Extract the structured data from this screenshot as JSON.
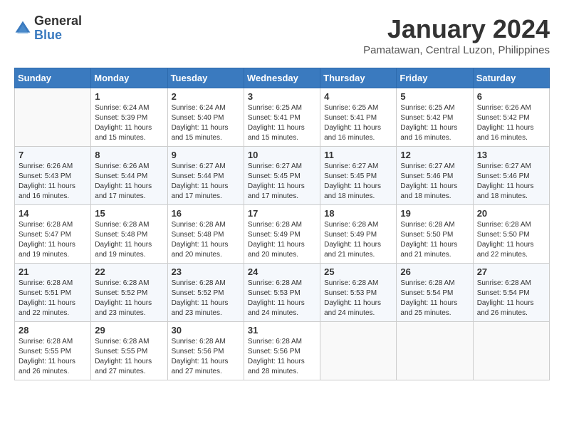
{
  "logo": {
    "general": "General",
    "blue": "Blue"
  },
  "header": {
    "month": "January 2024",
    "location": "Pamatawan, Central Luzon, Philippines"
  },
  "weekdays": [
    "Sunday",
    "Monday",
    "Tuesday",
    "Wednesday",
    "Thursday",
    "Friday",
    "Saturday"
  ],
  "weeks": [
    [
      {
        "day": "",
        "info": ""
      },
      {
        "day": "1",
        "info": "Sunrise: 6:24 AM\nSunset: 5:39 PM\nDaylight: 11 hours\nand 15 minutes."
      },
      {
        "day": "2",
        "info": "Sunrise: 6:24 AM\nSunset: 5:40 PM\nDaylight: 11 hours\nand 15 minutes."
      },
      {
        "day": "3",
        "info": "Sunrise: 6:25 AM\nSunset: 5:41 PM\nDaylight: 11 hours\nand 15 minutes."
      },
      {
        "day": "4",
        "info": "Sunrise: 6:25 AM\nSunset: 5:41 PM\nDaylight: 11 hours\nand 16 minutes."
      },
      {
        "day": "5",
        "info": "Sunrise: 6:25 AM\nSunset: 5:42 PM\nDaylight: 11 hours\nand 16 minutes."
      },
      {
        "day": "6",
        "info": "Sunrise: 6:26 AM\nSunset: 5:42 PM\nDaylight: 11 hours\nand 16 minutes."
      }
    ],
    [
      {
        "day": "7",
        "info": "Sunrise: 6:26 AM\nSunset: 5:43 PM\nDaylight: 11 hours\nand 16 minutes."
      },
      {
        "day": "8",
        "info": "Sunrise: 6:26 AM\nSunset: 5:44 PM\nDaylight: 11 hours\nand 17 minutes."
      },
      {
        "day": "9",
        "info": "Sunrise: 6:27 AM\nSunset: 5:44 PM\nDaylight: 11 hours\nand 17 minutes."
      },
      {
        "day": "10",
        "info": "Sunrise: 6:27 AM\nSunset: 5:45 PM\nDaylight: 11 hours\nand 17 minutes."
      },
      {
        "day": "11",
        "info": "Sunrise: 6:27 AM\nSunset: 5:45 PM\nDaylight: 11 hours\nand 18 minutes."
      },
      {
        "day": "12",
        "info": "Sunrise: 6:27 AM\nSunset: 5:46 PM\nDaylight: 11 hours\nand 18 minutes."
      },
      {
        "day": "13",
        "info": "Sunrise: 6:27 AM\nSunset: 5:46 PM\nDaylight: 11 hours\nand 18 minutes."
      }
    ],
    [
      {
        "day": "14",
        "info": "Sunrise: 6:28 AM\nSunset: 5:47 PM\nDaylight: 11 hours\nand 19 minutes."
      },
      {
        "day": "15",
        "info": "Sunrise: 6:28 AM\nSunset: 5:48 PM\nDaylight: 11 hours\nand 19 minutes."
      },
      {
        "day": "16",
        "info": "Sunrise: 6:28 AM\nSunset: 5:48 PM\nDaylight: 11 hours\nand 20 minutes."
      },
      {
        "day": "17",
        "info": "Sunrise: 6:28 AM\nSunset: 5:49 PM\nDaylight: 11 hours\nand 20 minutes."
      },
      {
        "day": "18",
        "info": "Sunrise: 6:28 AM\nSunset: 5:49 PM\nDaylight: 11 hours\nand 21 minutes."
      },
      {
        "day": "19",
        "info": "Sunrise: 6:28 AM\nSunset: 5:50 PM\nDaylight: 11 hours\nand 21 minutes."
      },
      {
        "day": "20",
        "info": "Sunrise: 6:28 AM\nSunset: 5:50 PM\nDaylight: 11 hours\nand 22 minutes."
      }
    ],
    [
      {
        "day": "21",
        "info": "Sunrise: 6:28 AM\nSunset: 5:51 PM\nDaylight: 11 hours\nand 22 minutes."
      },
      {
        "day": "22",
        "info": "Sunrise: 6:28 AM\nSunset: 5:52 PM\nDaylight: 11 hours\nand 23 minutes."
      },
      {
        "day": "23",
        "info": "Sunrise: 6:28 AM\nSunset: 5:52 PM\nDaylight: 11 hours\nand 23 minutes."
      },
      {
        "day": "24",
        "info": "Sunrise: 6:28 AM\nSunset: 5:53 PM\nDaylight: 11 hours\nand 24 minutes."
      },
      {
        "day": "25",
        "info": "Sunrise: 6:28 AM\nSunset: 5:53 PM\nDaylight: 11 hours\nand 24 minutes."
      },
      {
        "day": "26",
        "info": "Sunrise: 6:28 AM\nSunset: 5:54 PM\nDaylight: 11 hours\nand 25 minutes."
      },
      {
        "day": "27",
        "info": "Sunrise: 6:28 AM\nSunset: 5:54 PM\nDaylight: 11 hours\nand 26 minutes."
      }
    ],
    [
      {
        "day": "28",
        "info": "Sunrise: 6:28 AM\nSunset: 5:55 PM\nDaylight: 11 hours\nand 26 minutes."
      },
      {
        "day": "29",
        "info": "Sunrise: 6:28 AM\nSunset: 5:55 PM\nDaylight: 11 hours\nand 27 minutes."
      },
      {
        "day": "30",
        "info": "Sunrise: 6:28 AM\nSunset: 5:56 PM\nDaylight: 11 hours\nand 27 minutes."
      },
      {
        "day": "31",
        "info": "Sunrise: 6:28 AM\nSunset: 5:56 PM\nDaylight: 11 hours\nand 28 minutes."
      },
      {
        "day": "",
        "info": ""
      },
      {
        "day": "",
        "info": ""
      },
      {
        "day": "",
        "info": ""
      }
    ]
  ]
}
